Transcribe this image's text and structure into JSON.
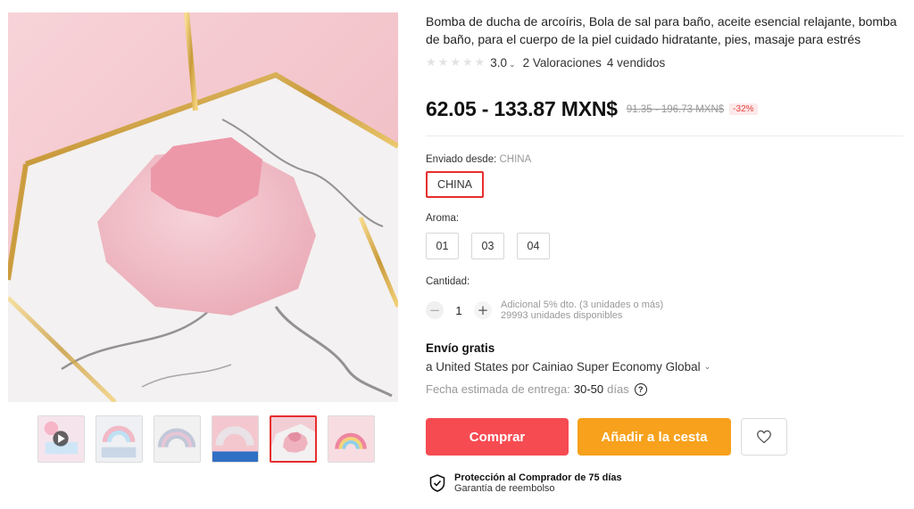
{
  "product": {
    "title": "Bomba de ducha de arcoíris, Bola de sal para baño, aceite esencial relajante, bomba de baño, para el cuerpo de la piel cuidado hidratante, pies, masaje para estrés",
    "rating": {
      "stars": 5,
      "value": "3.0",
      "reviews": "2 Valoraciones",
      "sold": "4 vendidos"
    },
    "price": {
      "current": "62.05 - 133.87 MXN$",
      "original": "91.35 - 196.73 MXN$",
      "discount": "-32%"
    }
  },
  "options": {
    "ship_from_label": "Enviado desde:",
    "ship_from_value": "CHINA",
    "ship_from_choices": [
      "CHINA"
    ],
    "aroma_label": "Aroma:",
    "aroma_choices": [
      "01",
      "03",
      "04"
    ]
  },
  "quantity": {
    "label": "Cantidad:",
    "value": "1",
    "decrement": "−",
    "increment": "+",
    "note_discount": "Adicional 5% dto. (3 unidades o más)",
    "note_stock": "29993 unidades disponibles"
  },
  "shipping": {
    "title": "Envío gratis",
    "line": "a United States por Cainiao Super Economy Global",
    "delivery_label": "Fecha estimada de entrega:",
    "delivery_days": "30-50",
    "delivery_unit": "días"
  },
  "actions": {
    "buy": "Comprar",
    "add_to_cart": "Añadir a la cesta",
    "wishlist_icon": "heart-icon"
  },
  "protection": {
    "title": "Protección al Comprador de 75 días",
    "subtitle": "Garantía de reembolso",
    "icon": "shield-check-icon"
  },
  "gallery": {
    "thumbnail_count": 6,
    "active_index": 4
  },
  "colors": {
    "buy": "#f74b52",
    "cart": "#f7a11c",
    "selected_border": "#e62e2e",
    "discount": "#e6413d"
  }
}
